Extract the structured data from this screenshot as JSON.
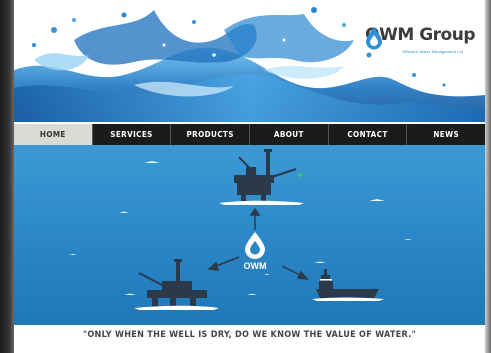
{
  "brand": {
    "name": "OWM Group",
    "tagline": "Offshore Water Management Ltd"
  },
  "nav": {
    "items": [
      {
        "label": "HOME",
        "active": true
      },
      {
        "label": "SERVICES",
        "active": false
      },
      {
        "label": "PRODUCTS",
        "active": false
      },
      {
        "label": "ABOUT",
        "active": false
      },
      {
        "label": "CONTACT",
        "active": false
      },
      {
        "label": "NEWS",
        "active": false
      }
    ]
  },
  "diagram": {
    "center_label": "OWM"
  },
  "quote": "\"ONLY WHEN THE WELL IS DRY, DO WE KNOW THE VALUE OF WATER.\"",
  "colors": {
    "sea": "#2d8dc9",
    "sea_light": "#66b6e3",
    "nav_bg": "#1b1b1b",
    "nav_active": "#d9d9d5",
    "brand_blue": "#2f8fd2",
    "structure": "#2b3a4a"
  }
}
